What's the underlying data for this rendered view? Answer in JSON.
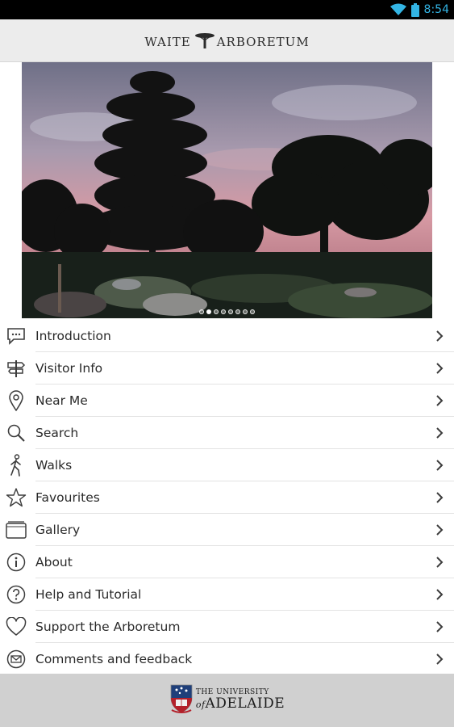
{
  "status_bar": {
    "time": "8:54",
    "accent_color": "#33b5e5",
    "icons": [
      "wifi-icon",
      "battery-icon"
    ]
  },
  "header": {
    "title_left": "WAITE",
    "title_right": "ARBORETUM",
    "logo_icon": "tree-logo-icon"
  },
  "hero": {
    "image": "sunset-garden-trees-photo",
    "slide_count": 8,
    "active_slide": 2
  },
  "menu": {
    "items": [
      {
        "label": "Introduction",
        "icon": "speech-bubble-icon"
      },
      {
        "label": "Visitor Info",
        "icon": "signpost-icon"
      },
      {
        "label": "Near Me",
        "icon": "location-pin-icon"
      },
      {
        "label": "Search",
        "icon": "search-icon"
      },
      {
        "label": "Walks",
        "icon": "walking-person-icon"
      },
      {
        "label": "Favourites",
        "icon": "star-icon"
      },
      {
        "label": "Gallery",
        "icon": "gallery-icon"
      },
      {
        "label": "About",
        "icon": "info-icon"
      },
      {
        "label": "Help and Tutorial",
        "icon": "help-icon"
      },
      {
        "label": "Support the Arboretum",
        "icon": "heart-icon"
      },
      {
        "label": "Comments and feedback",
        "icon": "mail-icon"
      }
    ],
    "chevron_icon": "chevron-right-icon"
  },
  "footer": {
    "line1": "THE UNIVERSITY",
    "line2_prefix": "of",
    "line2": "ADELAIDE",
    "crest_icon": "university-crest-icon"
  }
}
